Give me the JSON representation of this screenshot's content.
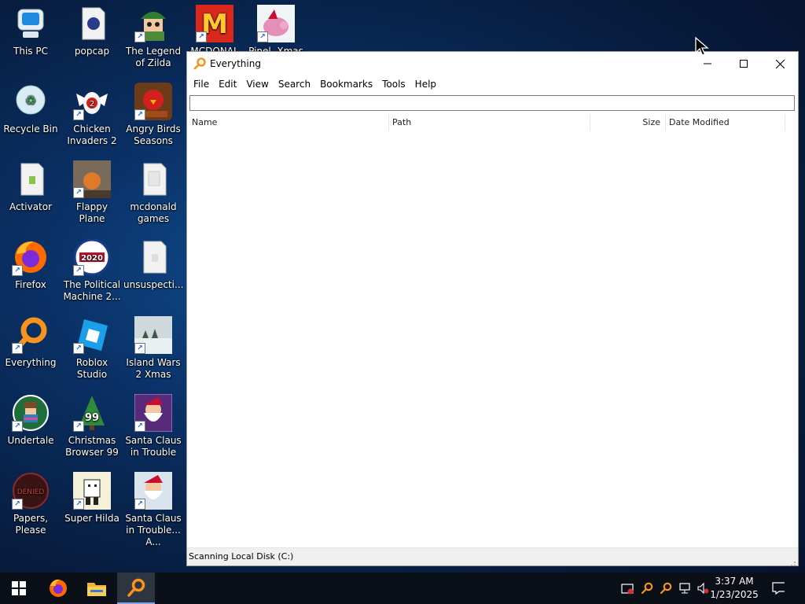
{
  "desktop": {
    "icons": [
      {
        "label": "This PC"
      },
      {
        "label": "popcap"
      },
      {
        "label": "The Legend of Zilda"
      },
      {
        "label": "MCDONAL"
      },
      {
        "label": "Pinel. Xmas"
      },
      {
        "label": "Recycle Bin"
      },
      {
        "label": "Chicken Invaders 2"
      },
      {
        "label": "Angry Birds Seasons"
      },
      {
        "label": "Activator"
      },
      {
        "label": "Flappy Plane"
      },
      {
        "label": "mcdonald games"
      },
      {
        "label": "Firefox"
      },
      {
        "label": "The Political Machine 2..."
      },
      {
        "label": "unsuspecti..."
      },
      {
        "label": "Everything"
      },
      {
        "label": "Roblox Studio"
      },
      {
        "label": "Island Wars 2 Xmas"
      },
      {
        "label": "Undertale"
      },
      {
        "label": "Christmas Browser 99"
      },
      {
        "label": "Santa Claus in Trouble"
      },
      {
        "label": "Papers, Please"
      },
      {
        "label": "Super Hilda"
      },
      {
        "label": "Santa Claus in Trouble... A..."
      }
    ]
  },
  "window": {
    "title": "Everything",
    "menu": [
      "File",
      "Edit",
      "View",
      "Search",
      "Bookmarks",
      "Tools",
      "Help"
    ],
    "search": {
      "value": "",
      "placeholder": ""
    },
    "columns": [
      "Name",
      "Path",
      "Size",
      "Date Modified"
    ],
    "status": "Scanning Local Disk (C:)"
  },
  "taskbar": {
    "clock_time": "3:37 AM",
    "clock_date": "1/23/2025",
    "pinned": [
      "start-icon",
      "firefox-icon",
      "file-explorer-icon",
      "everything-icon"
    ]
  },
  "colors": {
    "accent": "#f7941d",
    "taskbar": "#0b0f17",
    "desktop": "#0a2f63"
  }
}
